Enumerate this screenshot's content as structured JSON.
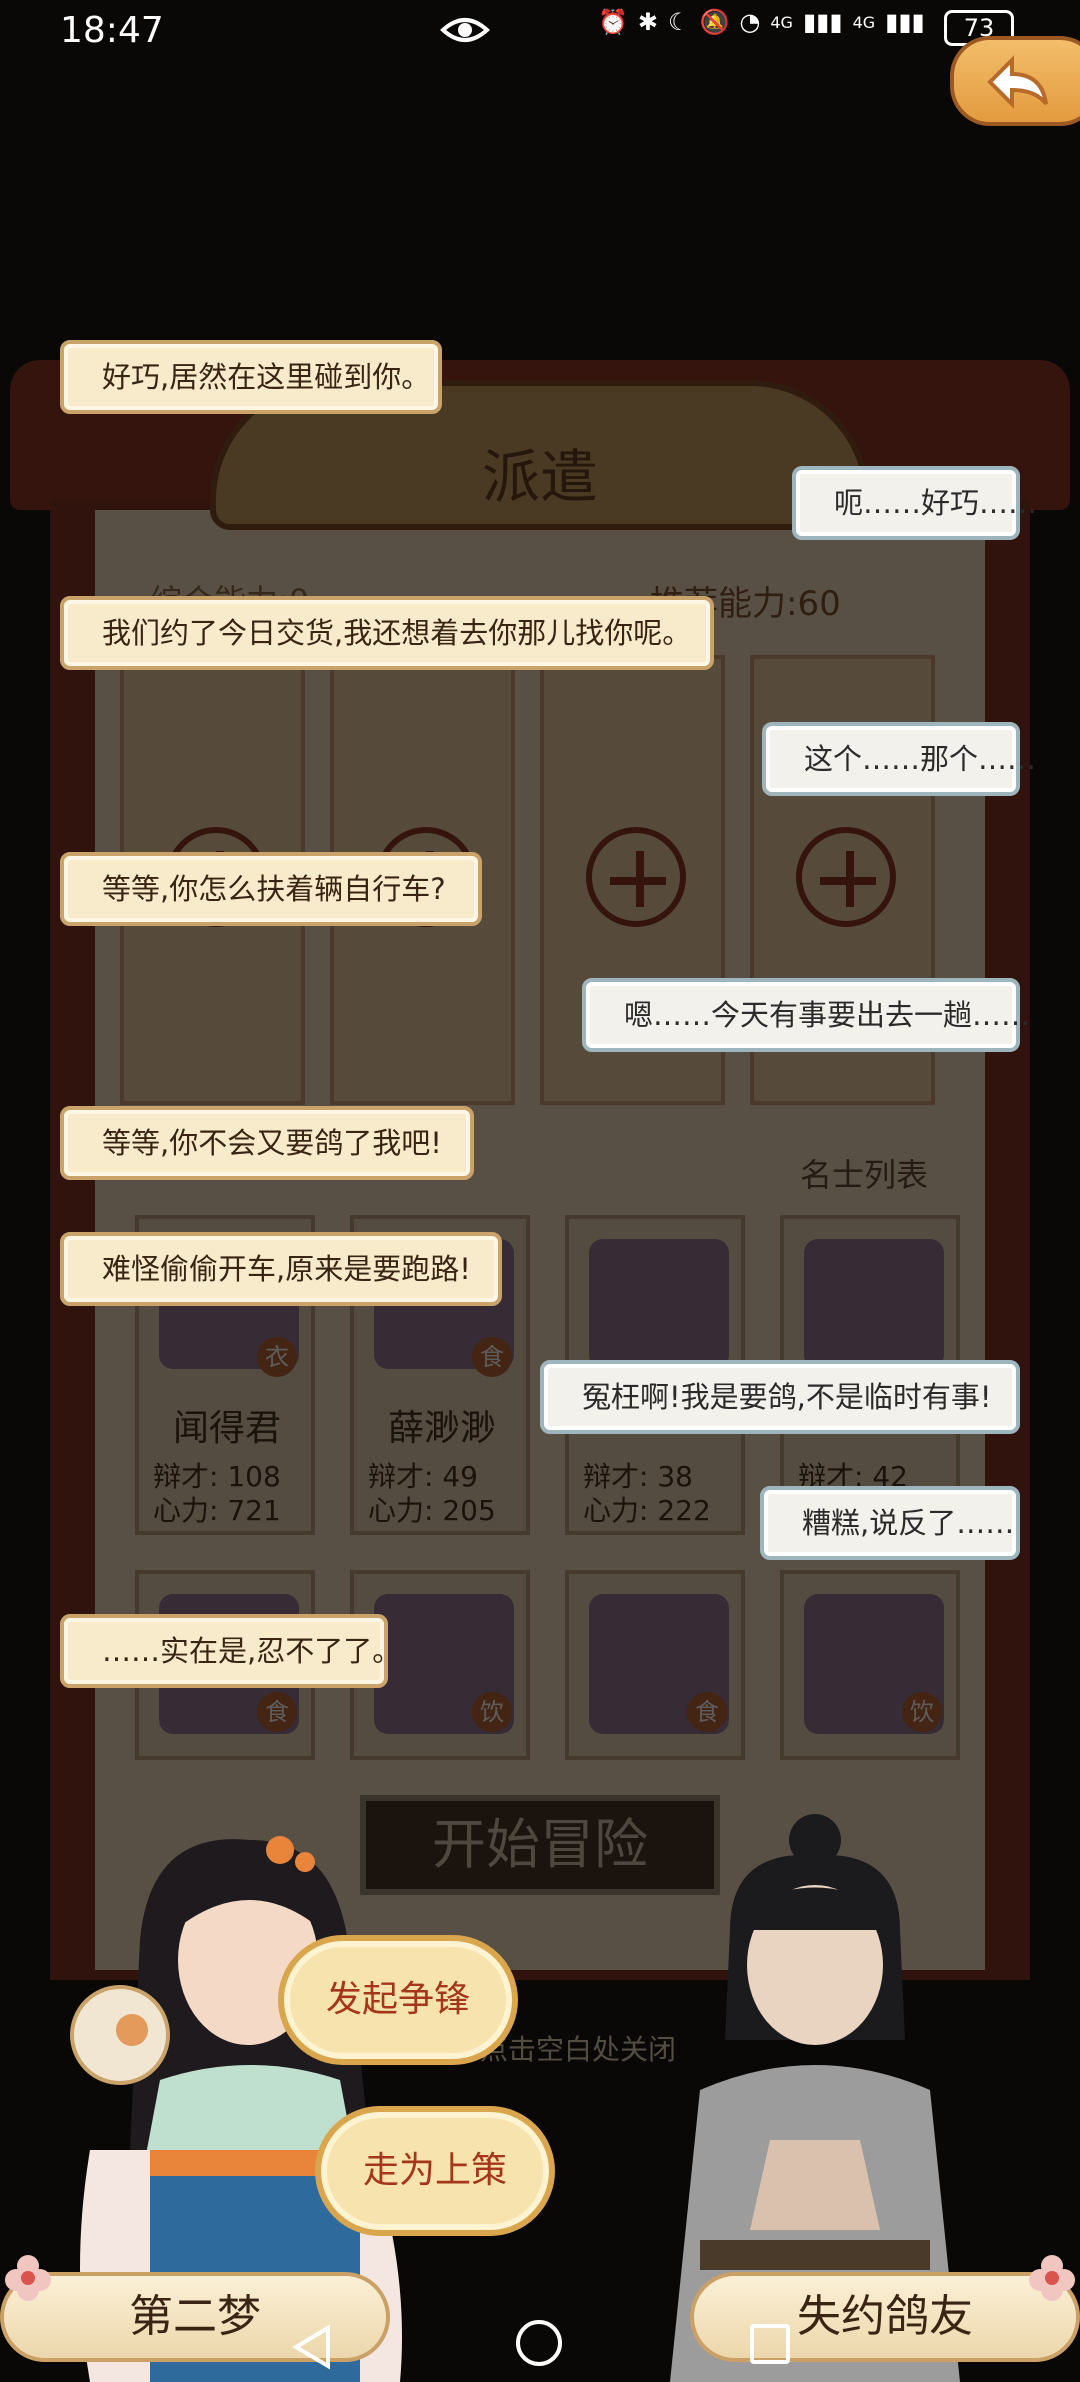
{
  "status_bar": {
    "time": "18:47",
    "network_1": "4G",
    "network_2": "4G",
    "battery": "73"
  },
  "background_panel": {
    "title": "派遣",
    "ability_left": "综合能力:0",
    "ability_right": "推荐能力:60",
    "list_title": "名士列表",
    "start_button": "开始冒险",
    "close_hint": "点击空白处关闭",
    "cards": [
      {
        "name": "闻得君",
        "badge": "衣",
        "bian": "辩才: 108",
        "xin": "心力: 721"
      },
      {
        "name": "薛渺渺",
        "badge": "食",
        "bian": "辩才: 49",
        "xin": "心力: 205"
      },
      {
        "name": "",
        "badge": "",
        "bian": "辩才: 38",
        "xin": "心力: 222"
      },
      {
        "name": "",
        "badge": "",
        "bian": "辩才: 42",
        "xin": ""
      }
    ],
    "cards_row2": [
      {
        "badge": "食"
      },
      {
        "badge": "饮"
      },
      {
        "badge": "食"
      },
      {
        "badge": "饮"
      }
    ]
  },
  "dialogue": [
    {
      "side": "left",
      "text": "好巧,居然在这里碰到你。"
    },
    {
      "side": "right",
      "text": "呃……好巧……"
    },
    {
      "side": "left",
      "text": "我们约了今日交货,我还想着去你那儿找你呢。"
    },
    {
      "side": "right",
      "text": "这个……那个……"
    },
    {
      "side": "left",
      "text": "等等,你怎么扶着辆自行车?"
    },
    {
      "side": "right",
      "text": "嗯……今天有事要出去一趟……"
    },
    {
      "side": "left",
      "text": "等等,你不会又要鸽了我吧!"
    },
    {
      "side": "left",
      "text": "难怪偷偷开车,原来是要跑路!"
    },
    {
      "side": "right",
      "text": "冤枉啊!我是要鸽,不是临时有事!"
    },
    {
      "side": "right",
      "text": "糟糕,说反了……"
    },
    {
      "side": "left",
      "text": "……实在是,忍不了了。"
    }
  ],
  "choices": {
    "option_1": "发起争锋",
    "option_2": "走为上策"
  },
  "characters": {
    "left_name": "第二梦",
    "right_name": "失约鸽友"
  },
  "colors": {
    "bubble_left_bg": "#f7ebcc",
    "bubble_right_bg": "#f3f1eb",
    "accent_red": "#a4361c",
    "frame_red": "#7a2a1c"
  }
}
